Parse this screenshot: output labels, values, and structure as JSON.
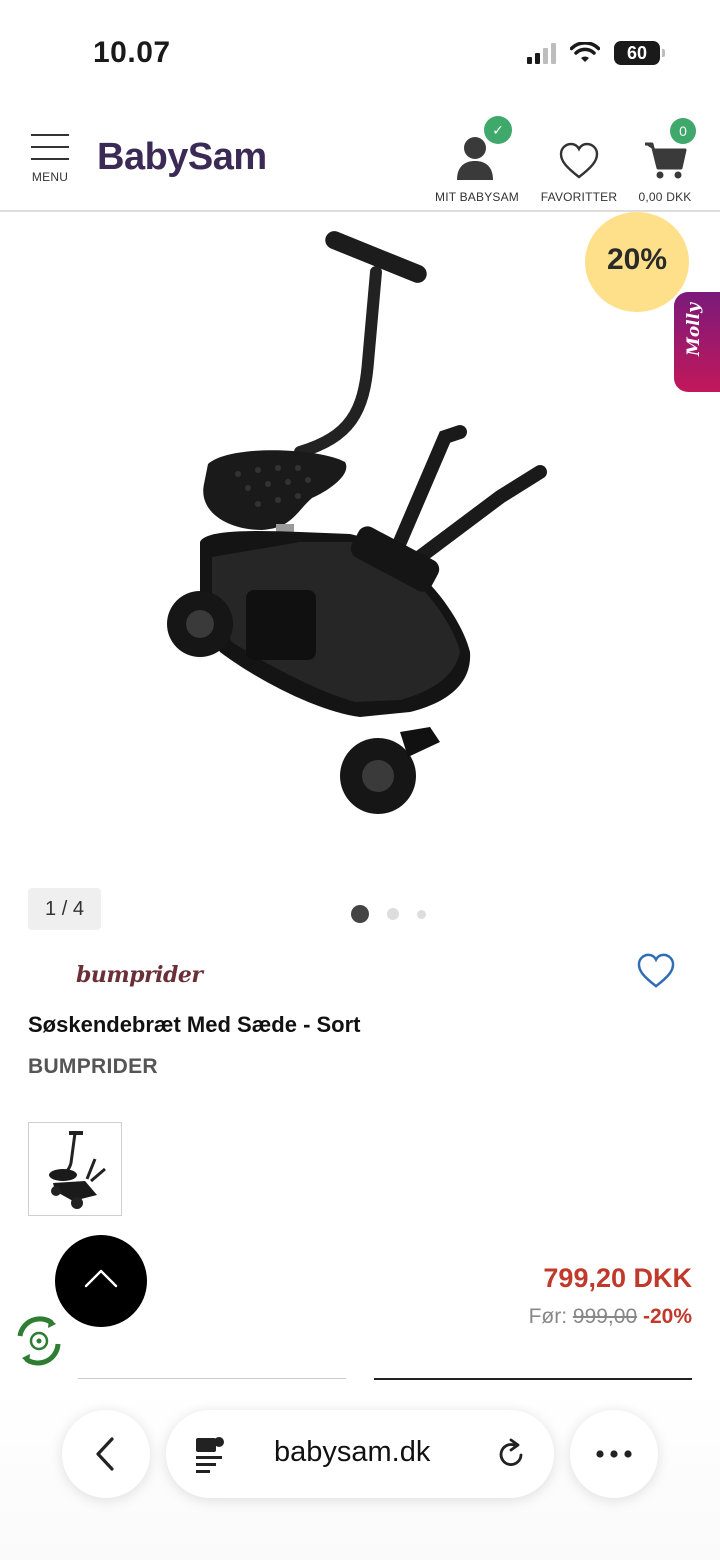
{
  "status_bar": {
    "time": "10.07",
    "battery": "60"
  },
  "header": {
    "menu_label": "MENU",
    "logo": "BabySam",
    "account_label": "MIT BABYSAM",
    "favorites_label": "FAVORITTER",
    "cart_total": "0,00 DKK",
    "cart_count": "0",
    "colors": {
      "brand": "#3b2a55",
      "badge_green": "#3fa86b",
      "cart_badge": "#3fa86b"
    }
  },
  "gallery": {
    "sale_badge": "20%",
    "chat_tab": "Molly",
    "counter": "1 / 4",
    "dots": 3,
    "active_dot": 0
  },
  "product": {
    "brand_logo": "bumprider",
    "title": "Søskendebræt Med Sæde - Sort",
    "brand": "BUMPRIDER",
    "price": "799,20 DKK",
    "old_price_prefix": "Før:",
    "old_price": "999,00",
    "discount": "-20%",
    "colors": {
      "price": "#c0392b"
    }
  },
  "browser": {
    "url": "babysam.dk"
  }
}
